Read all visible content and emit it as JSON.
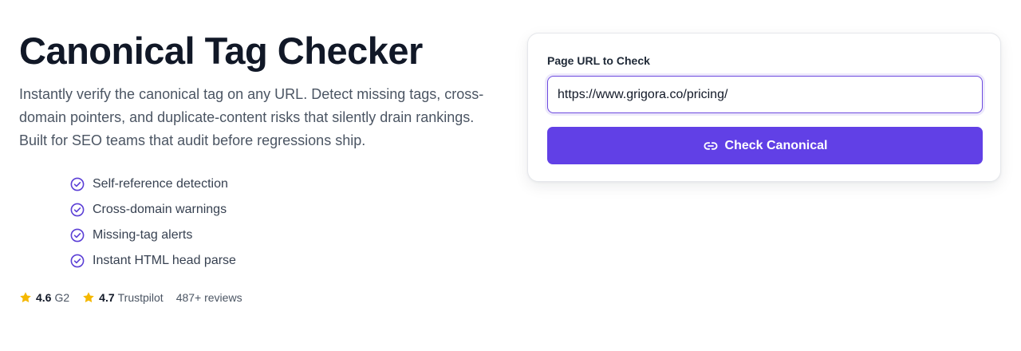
{
  "hero": {
    "title": "Canonical Tag Checker",
    "description": "Instantly verify the canonical tag on any URL. Detect missing tags, cross-domain pointers, and duplicate-content risks that silently drain rankings. Built for SEO teams that audit before regressions ship."
  },
  "features": [
    {
      "label": "Self-reference detection",
      "icon": "check-circle-icon"
    },
    {
      "label": "Cross-domain warnings",
      "icon": "check-circle-icon"
    },
    {
      "label": "Missing-tag alerts",
      "icon": "check-circle-icon"
    },
    {
      "label": "Instant HTML head parse",
      "icon": "check-circle-icon"
    }
  ],
  "ratings": {
    "g2": {
      "score": "4.6",
      "source": "G2",
      "icon": "star-icon"
    },
    "trustpilot": {
      "score": "4.7",
      "source": "Trustpilot",
      "icon": "star-icon"
    },
    "reviews": "487+ reviews"
  },
  "form": {
    "label": "Page URL to Check",
    "url_value": "https://www.grigora.co/pricing/",
    "button_label": "Check Canonical",
    "button_icon": "link-icon"
  },
  "colors": {
    "accent": "#6140e6",
    "check": "#5b3fd6",
    "star": "#f5b800",
    "title": "#111827"
  }
}
